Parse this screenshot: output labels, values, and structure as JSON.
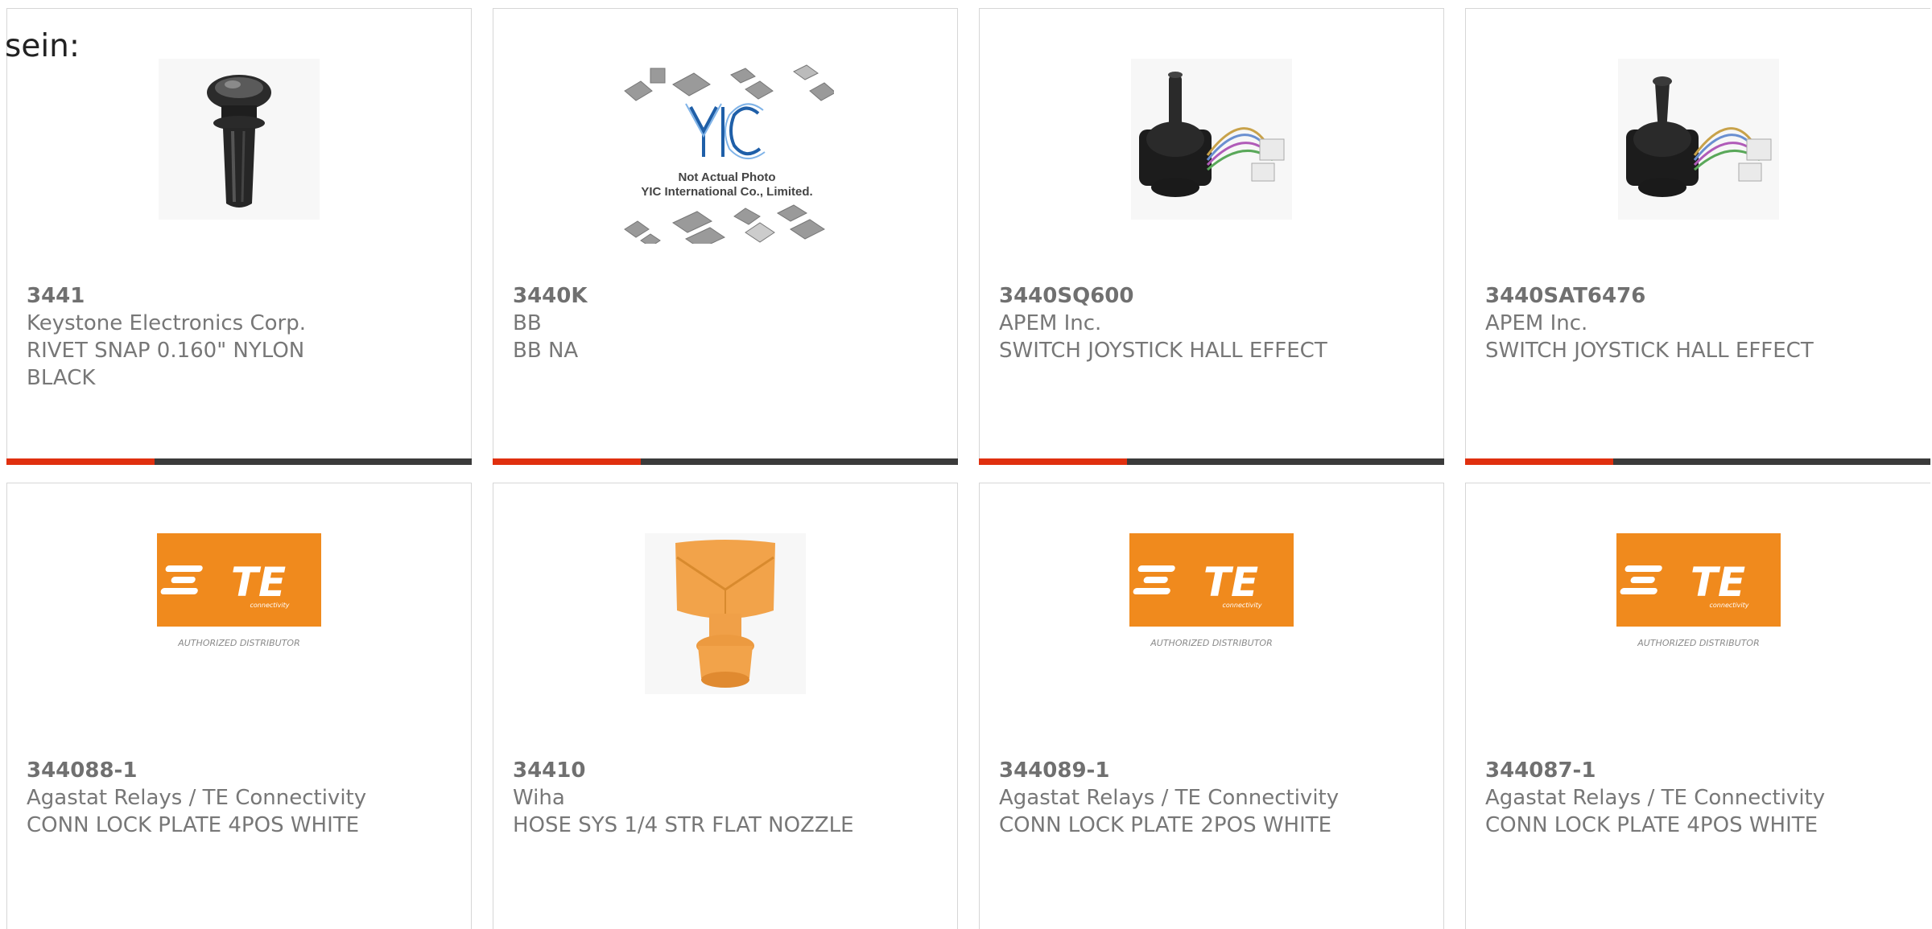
{
  "intro_text": "sein:",
  "products": [
    {
      "part_number": "3441",
      "manufacturer": "Keystone Electronics Corp.",
      "description": "RIVET SNAP 0.160\" NYLON BLACK",
      "image": "rivet-icon"
    },
    {
      "part_number": "3440K",
      "manufacturer": "BB",
      "description": "BB NA",
      "image": "placeholder-chips-icon",
      "image_text_1": "Not Actual Photo",
      "image_text_2": "YIC International Co., Limited.",
      "image_logo": "YIC"
    },
    {
      "part_number": "3440SQ600",
      "manufacturer": "APEM Inc.",
      "description": "SWITCH JOYSTICK HALL EFFECT",
      "image": "joystick-icon"
    },
    {
      "part_number": "3440SAT6476",
      "manufacturer": "APEM Inc.",
      "description": "SWITCH JOYSTICK HALL EFFECT",
      "image": "joystick-icon"
    },
    {
      "part_number": "344088-1",
      "manufacturer": "Agastat Relays / TE Connectivity",
      "description": "CONN LOCK PLATE 4POS WHITE",
      "image": "te-logo",
      "logo_text": "TE",
      "logo_sub": "connectivity",
      "logo_caption": "AUTHORIZED DISTRIBUTOR"
    },
    {
      "part_number": "34410",
      "manufacturer": "Wiha",
      "description": "HOSE SYS 1/4 STR FLAT NOZZLE",
      "image": "nozzle-icon"
    },
    {
      "part_number": "344089-1",
      "manufacturer": "Agastat Relays / TE Connectivity",
      "description": "CONN LOCK PLATE 2POS WHITE",
      "image": "te-logo",
      "logo_text": "TE",
      "logo_sub": "connectivity",
      "logo_caption": "AUTHORIZED DISTRIBUTOR"
    },
    {
      "part_number": "344087-1",
      "manufacturer": "Agastat Relays / TE Connectivity",
      "description": "CONN LOCK PLATE 4POS WHITE",
      "image": "te-logo",
      "logo_text": "TE",
      "logo_sub": "connectivity",
      "logo_caption": "AUTHORIZED DISTRIBUTOR"
    }
  ],
  "colors": {
    "accent": "#e0300f",
    "bar": "#3b3b3b",
    "te_orange": "#f08a1d"
  }
}
